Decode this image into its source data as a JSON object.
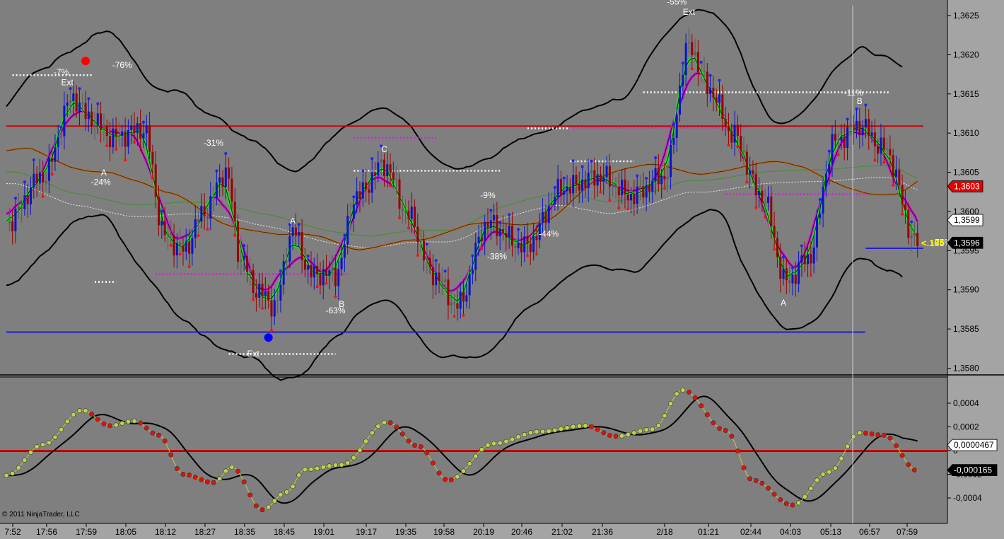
{
  "copyright": "© 2011 NinjaTrader, LLC",
  "colors": {
    "background": "#7f7f7f",
    "axis_bg": "#a4a4a4",
    "up_bar": "#0a14cc",
    "down_bar": "#9a0000",
    "neutral_bar": "#5a5a5a",
    "band": "#000000",
    "red_level": "#d00000",
    "blue_level": "#1f1fd0",
    "green_ma": "#27e027",
    "magenta_ma": "#d21fd2",
    "orange_ma": "#b86a1a",
    "osc_up_dot": "#b5d84a",
    "osc_down_dot": "#e01010"
  },
  "chart_data": [
    {
      "type": "candlestick",
      "panel": "price",
      "x_tick_labels": [
        "7:52",
        "17:56",
        "17:59",
        "18:05",
        "18:12",
        "18:27",
        "18:35",
        "18:45",
        "19:01",
        "19:17",
        "19:35",
        "19:58",
        "20:19",
        "20:46",
        "21:02",
        "21:36",
        "2/18",
        "01:21",
        "02:44",
        "04:03",
        "05:13",
        "06:57",
        "07:59"
      ],
      "y_tick_labels": [
        "1,3580",
        "1,3585",
        "1,3590",
        "1,3595",
        "1,3600",
        "1,3605",
        "1,3610",
        "1,3615",
        "1,3620",
        "1,3625"
      ],
      "ylim": [
        1.35785,
        1.36265
      ],
      "price_markers": [
        {
          "label": "1,3603",
          "value": 1.36032,
          "style": "red"
        },
        {
          "label": "1,3599",
          "value": 1.35989,
          "style": "white"
        },
        {
          "label": "1,3596",
          "value": 1.3596,
          "style": "black"
        }
      ],
      "overlay_text": "<.185",
      "horizontal_levels": [
        {
          "name": "red-level",
          "value": 1.36109,
          "from_bar": 0,
          "to_bar": 299
        },
        {
          "name": "blue-level-low",
          "value": 1.35846,
          "from_bar": 0,
          "to_bar": 280
        },
        {
          "name": "blue-level-last",
          "value": 1.35953,
          "from_bar": 282,
          "to_bar": 299
        }
      ],
      "dotted_levels": [
        {
          "color": "white",
          "value": 1.36174,
          "from_bar": 2,
          "to_bar": 28
        },
        {
          "color": "white",
          "value": 1.3591,
          "from_bar": 29,
          "to_bar": 36
        },
        {
          "color": "magenta",
          "value": 1.3592,
          "from_bar": 49,
          "to_bar": 112
        },
        {
          "color": "white",
          "value": 1.35818,
          "from_bar": 73,
          "to_bar": 108
        },
        {
          "color": "magenta",
          "value": 1.36094,
          "from_bar": 114,
          "to_bar": 141
        },
        {
          "color": "white",
          "value": 1.36052,
          "from_bar": 114,
          "to_bar": 162
        },
        {
          "color": "white",
          "value": 1.36064,
          "from_bar": 185,
          "to_bar": 206
        },
        {
          "color": "white",
          "value": 1.36106,
          "from_bar": 171,
          "to_bar": 185
        },
        {
          "color": "magenta",
          "value": 1.36107,
          "from_bar": 185,
          "to_bar": 243
        },
        {
          "color": "white",
          "value": 1.36152,
          "from_bar": 209,
          "to_bar": 290
        },
        {
          "color": "magenta",
          "value": 1.36022,
          "from_bar": 236,
          "to_bar": 295
        }
      ],
      "annotations": [
        {
          "text": "-7%",
          "bar": 18,
          "price": 1.36174
        },
        {
          "text": "Ext",
          "bar": 20,
          "price": 1.36161
        },
        {
          "text": "-76%",
          "bar": 38,
          "price": 1.36183
        },
        {
          "text": "-24%",
          "bar": 31,
          "price": 1.36034
        },
        {
          "text": "A",
          "bar": 32,
          "price": 1.36046
        },
        {
          "text": "-31%",
          "bar": 68,
          "price": 1.36084
        },
        {
          "text": "A",
          "bar": 94,
          "price": 1.35984
        },
        {
          "text": "Ext",
          "bar": 81,
          "price": 1.35815
        },
        {
          "text": "-63%",
          "bar": 108,
          "price": 1.3587
        },
        {
          "text": "B",
          "bar": 110,
          "price": 1.35878
        },
        {
          "text": "C",
          "bar": 124,
          "price": 1.36076
        },
        {
          "text": "-9%",
          "bar": 158,
          "price": 1.36017
        },
        {
          "text": "-44%",
          "bar": 178,
          "price": 1.35968
        },
        {
          "text": "-38%",
          "bar": 161,
          "price": 1.35939
        },
        {
          "text": "-55%",
          "bar": 220,
          "price": 1.36264
        },
        {
          "text": "Ext",
          "bar": 224,
          "price": 1.36251
        },
        {
          "text": "-11%",
          "bar": 278,
          "price": 1.36148
        },
        {
          "text": "B",
          "bar": 280,
          "price": 1.36137
        },
        {
          "text": "A",
          "bar": 255,
          "price": 1.3588
        },
        {
          "text": "-75%",
          "bar": 307,
          "price": 1.35957
        }
      ],
      "signal_dots": [
        {
          "color": "red",
          "bar": 26,
          "price": 1.36192
        },
        {
          "color": "blue",
          "bar": 86,
          "price": 1.35839
        }
      ]
    },
    {
      "type": "line",
      "panel": "oscillator",
      "y_tick_labels": [
        "-0,0004",
        "-0,0002",
        "0",
        "0,0002",
        "0,0004"
      ],
      "ylim": [
        -0.00055,
        0.00052
      ],
      "price_markers": [
        {
          "label": "0,0000467",
          "value": 4.67e-05,
          "style": "white"
        },
        {
          "label": "-0,000165",
          "value": -0.000165,
          "style": "black"
        }
      ],
      "zero_line": 0,
      "knots": [
        {
          "bar": 0,
          "value": -0.00021
        },
        {
          "bar": 12,
          "value": 5e-05
        },
        {
          "bar": 25,
          "value": 0.00034
        },
        {
          "bar": 34,
          "value": 0.00021
        },
        {
          "bar": 42,
          "value": 0.00025
        },
        {
          "bar": 50,
          "value": 0.00013
        },
        {
          "bar": 58,
          "value": -0.0002
        },
        {
          "bar": 68,
          "value": -0.00027
        },
        {
          "bar": 74,
          "value": -0.00014
        },
        {
          "bar": 84,
          "value": -0.0005
        },
        {
          "bar": 92,
          "value": -0.00035
        },
        {
          "bar": 98,
          "value": -0.00016
        },
        {
          "bar": 110,
          "value": -0.00012
        },
        {
          "bar": 125,
          "value": 0.00024
        },
        {
          "bar": 135,
          "value": 4e-05
        },
        {
          "bar": 145,
          "value": -0.00025
        },
        {
          "bar": 160,
          "value": 6e-05
        },
        {
          "bar": 175,
          "value": 0.00016
        },
        {
          "bar": 190,
          "value": 0.00021
        },
        {
          "bar": 200,
          "value": 0.00012
        },
        {
          "bar": 212,
          "value": 0.00018
        },
        {
          "bar": 222,
          "value": 0.00051
        },
        {
          "bar": 236,
          "value": 0.00017
        },
        {
          "bar": 245,
          "value": -0.00025
        },
        {
          "bar": 258,
          "value": -0.00046
        },
        {
          "bar": 270,
          "value": -0.00018
        },
        {
          "bar": 280,
          "value": 0.00015
        },
        {
          "bar": 288,
          "value": 0.00013
        },
        {
          "bar": 299,
          "value": -0.00017
        }
      ]
    }
  ]
}
